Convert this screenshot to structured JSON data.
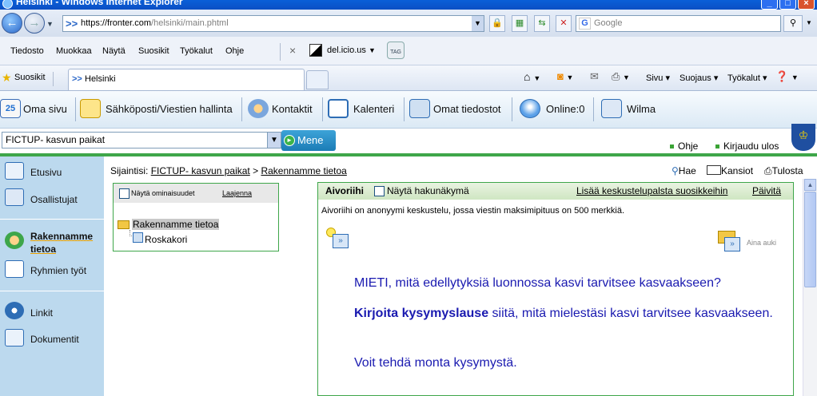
{
  "window": {
    "title": "Helsinki - Windows Internet Explorer"
  },
  "address_bar": {
    "url_prefix": "https://fronter.com",
    "url_path": "/helsinki/main.phtml",
    "search_placeholder": "Google"
  },
  "menu": {
    "items": [
      "Tiedosto",
      "Muokkaa",
      "Näytä",
      "Suosikit",
      "Työkalut",
      "Ohje"
    ],
    "delicious_label": "del.icio.us",
    "tag_label": "TAG"
  },
  "favorites": {
    "label": "Suosikit",
    "tab_label": "Helsinki",
    "commands": {
      "page": "Sivu",
      "security": "Suojaus",
      "tools": "Työkalut"
    }
  },
  "app_toolbar": {
    "items": [
      "Oma sivu",
      "Sähköposti/Viestien hallinta",
      "Kontaktit",
      "Kalenteri",
      "Omat tiedostot",
      "Online:0",
      "Wilma"
    ],
    "calendar_day": "25"
  },
  "context": {
    "selected_room": "FICTUP- kasvun paikat",
    "go_label": "Mene",
    "help_label": "Ohje",
    "logout_label": "Kirjaudu ulos"
  },
  "sidebar": {
    "items": [
      "Etusivu",
      "Osallistujat",
      "Rakennamme tietoa",
      "Ryhmien työt",
      "Linkit",
      "Dokumentit"
    ],
    "active_index": 2
  },
  "breadcrumb": {
    "prefix": "Sijaintisi:",
    "parent": "FICTUP- kasvun paikat",
    "separator": ">",
    "current": "Rakennamme tietoa"
  },
  "page_tools": {
    "search": "Hae",
    "folders": "Kansiot",
    "print": "Tulosta"
  },
  "tree": {
    "show_properties": "Näytä ominaisuudet",
    "expand": "Laajenna",
    "root": "Rakennamme tietoa",
    "child": "Roskakori"
  },
  "forum": {
    "title": "Aivoriihi",
    "show_search_view": "Näytä hakunäkymä",
    "add_to_favorites": "Lisää keskustelupalsta suosikkeihin",
    "refresh": "Päivitä",
    "description": "Aivoriihi on anonyymi keskustelu, jossa viestin maksimipituus on 500 merkkiä.",
    "always_open": "Aina auki",
    "paragraph1": "MIETI, mitä edellytyksiä luonnossa kasvi tarvitsee kasvaakseen?",
    "paragraph2_bold": "Kirjoita kysymyslause",
    "paragraph2_rest": " siitä, mitä mielestäsi kasvi tarvitsee kasvaakseen.",
    "paragraph3": "Voit tehdä monta kysymystä."
  }
}
